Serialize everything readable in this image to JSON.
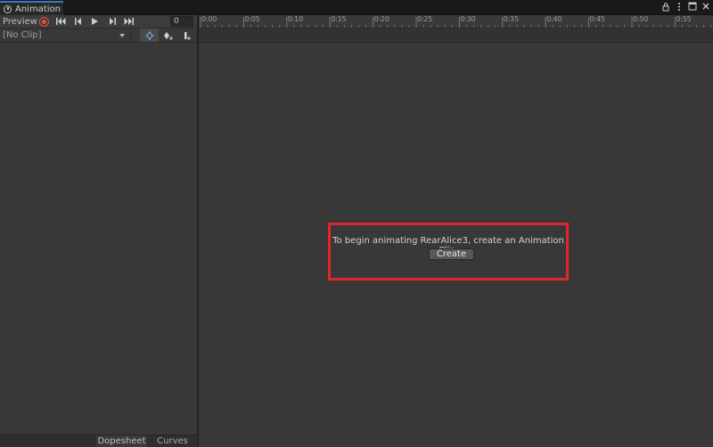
{
  "window": {
    "tab_title": "Animation",
    "icons": [
      "lock-icon",
      "more-vert-icon",
      "maximize-icon",
      "close-icon"
    ]
  },
  "toolbar": {
    "preview_label": "Preview",
    "buttons": [
      "record-icon",
      "skip-to-start-icon",
      "prev-key-icon",
      "play-icon",
      "next-key-icon",
      "skip-to-end-icon"
    ],
    "frame_value": "0"
  },
  "clip_row": {
    "clip_select_value": "[No Clip]",
    "buttons": [
      "add-keyframe-icon",
      "add-event-icon",
      "filter-by-selection-icon"
    ]
  },
  "bottom_tabs": {
    "dopesheet": "Dopesheet",
    "curves": "Curves"
  },
  "ruler": {
    "labels": [
      "0:00",
      "0:05",
      "0:10",
      "0:15",
      "0:20",
      "0:25",
      "0:30",
      "0:35",
      "0:40",
      "0:45",
      "0:50",
      "0:55"
    ]
  },
  "message": {
    "text": "To begin animating RearAlice3, create an Animation Clip.",
    "create_label": "Create"
  },
  "colors": {
    "accent": "#3a79bb",
    "record": "#e0543f",
    "highlight_box": "#e1252a"
  }
}
